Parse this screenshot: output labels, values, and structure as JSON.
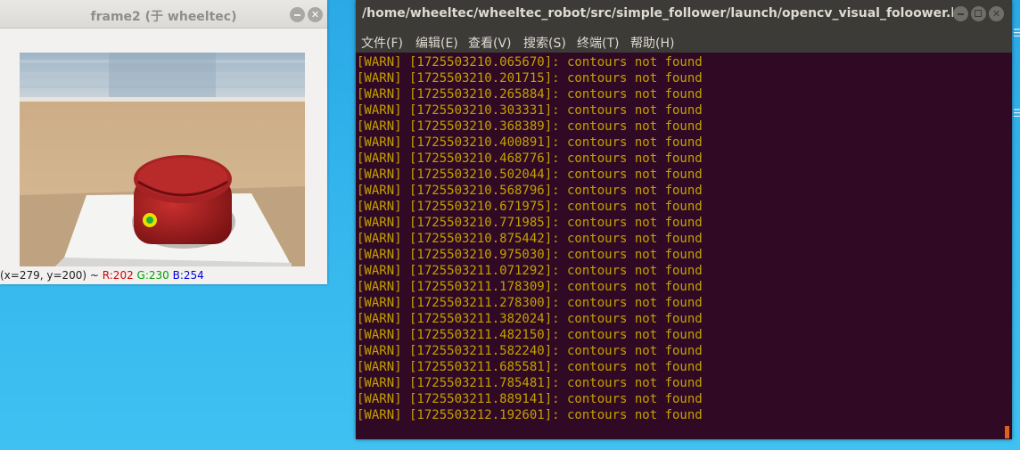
{
  "frame_window": {
    "title": "frame2 (于 wheeltec)",
    "status": {
      "coords": "(x=279, y=200) ~ ",
      "r": "R:202",
      "g": "G:230",
      "b": "B:254"
    }
  },
  "terminal_window": {
    "title": "/home/wheeltec/wheeltec_robot/src/simple_follower/launch/opencv_visual_foloower.laun...",
    "menu": [
      "文件(F)",
      "编辑(E)",
      "查看(V)",
      "搜索(S)",
      "终端(T)",
      "帮助(H)"
    ],
    "lines": [
      "[WARN] [1725503210.065670]: contours not found",
      "[WARN] [1725503210.201715]: contours not found",
      "[WARN] [1725503210.265884]: contours not found",
      "[WARN] [1725503210.303331]: contours not found",
      "[WARN] [1725503210.368389]: contours not found",
      "[WARN] [1725503210.400891]: contours not found",
      "[WARN] [1725503210.468776]: contours not found",
      "[WARN] [1725503210.502044]: contours not found",
      "[WARN] [1725503210.568796]: contours not found",
      "[WARN] [1725503210.671975]: contours not found",
      "[WARN] [1725503210.771985]: contours not found",
      "[WARN] [1725503210.875442]: contours not found",
      "[WARN] [1725503210.975030]: contours not found",
      "[WARN] [1725503211.071292]: contours not found",
      "[WARN] [1725503211.178309]: contours not found",
      "[WARN] [1725503211.278300]: contours not found",
      "[WARN] [1725503211.382024]: contours not found",
      "[WARN] [1725503211.482150]: contours not found",
      "[WARN] [1725503211.582240]: contours not found",
      "[WARN] [1725503211.685581]: contours not found",
      "[WARN] [1725503211.785481]: contours not found",
      "[WARN] [1725503211.889141]: contours not found",
      "[WARN] [1725503212.192601]: contours not found"
    ]
  },
  "colors": {
    "terminal_bg": "#300a24",
    "warn_text": "#c4a000",
    "desktop": "#36b8ee"
  }
}
